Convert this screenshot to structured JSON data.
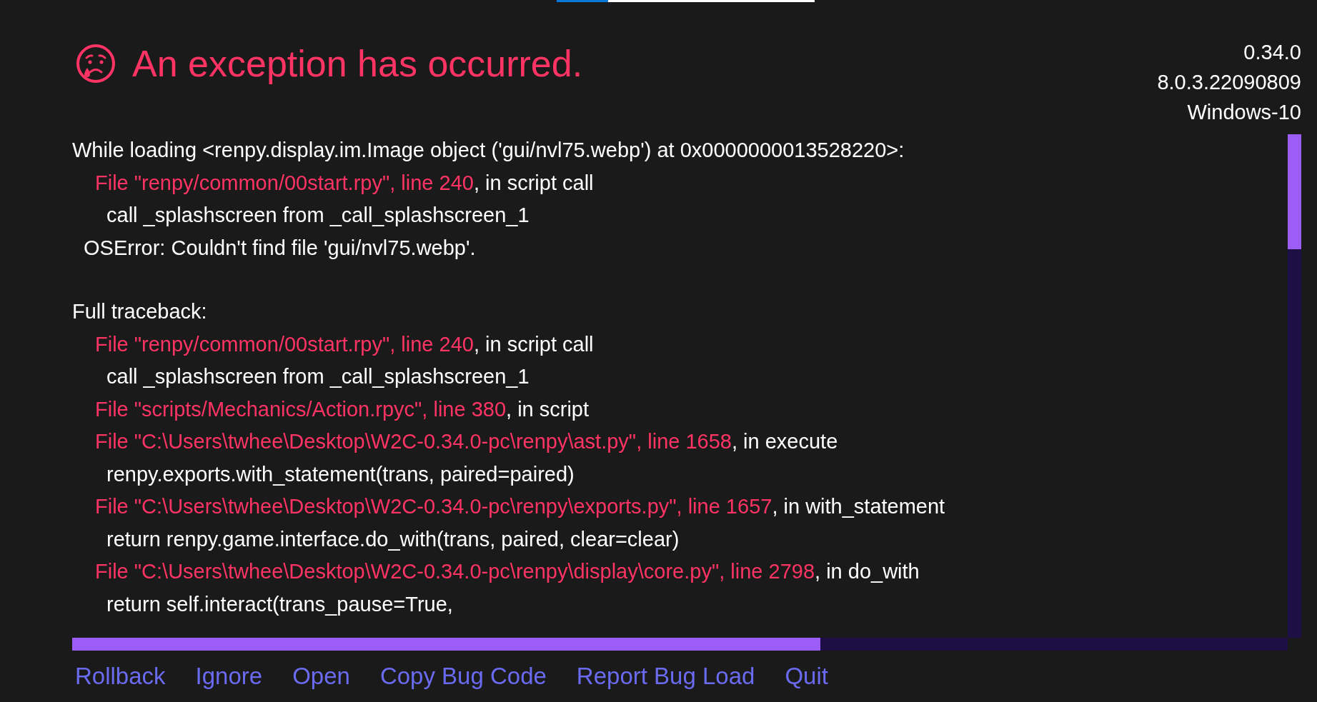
{
  "title": "An exception has occurred.",
  "versions": [
    "0.34.0",
    "8.0.3.22090809",
    "Windows-10"
  ],
  "sections": [
    {
      "lines": [
        {
          "kind": "header",
          "text": "While loading <renpy.display.im.Image object ('gui/nvl75.webp') at 0x0000000013528220>:"
        },
        {
          "kind": "frame",
          "location": "File \"renpy/common/00start.rpy\", line 240",
          "rest": ", in script call"
        },
        {
          "kind": "code",
          "text": "call _splashscreen from _call_splashscreen_1"
        },
        {
          "kind": "error",
          "text": "OSError: Couldn't find file 'gui/nvl75.webp'."
        }
      ]
    },
    {
      "lines": [
        {
          "kind": "header",
          "text": "Full traceback:"
        },
        {
          "kind": "frame",
          "location": "File \"renpy/common/00start.rpy\", line 240",
          "rest": ", in script call"
        },
        {
          "kind": "code",
          "text": "call _splashscreen from _call_splashscreen_1"
        },
        {
          "kind": "frame",
          "location": "File \"scripts/Mechanics/Action.rpyc\", line 380",
          "rest": ", in script"
        },
        {
          "kind": "frame",
          "location": "File \"C:\\Users\\twhee\\Desktop\\W2C-0.34.0-pc\\renpy\\ast.py\", line 1658",
          "rest": ", in execute"
        },
        {
          "kind": "code",
          "text": "renpy.exports.with_statement(trans, paired=paired)"
        },
        {
          "kind": "frame",
          "location": "File \"C:\\Users\\twhee\\Desktop\\W2C-0.34.0-pc\\renpy\\exports.py\", line 1657",
          "rest": ", in with_statement"
        },
        {
          "kind": "code",
          "text": "return renpy.game.interface.do_with(trans, paired, clear=clear)"
        },
        {
          "kind": "frame",
          "location": "File \"C:\\Users\\twhee\\Desktop\\W2C-0.34.0-pc\\renpy\\display\\core.py\", line 2798",
          "rest": ", in do_with"
        },
        {
          "kind": "code",
          "text": "return self.interact(trans_pause=True,"
        }
      ]
    }
  ],
  "buttons": [
    "Rollback",
    "Ignore",
    "Open",
    "Copy Bug Code",
    "Report Bug Load",
    "Quit"
  ]
}
